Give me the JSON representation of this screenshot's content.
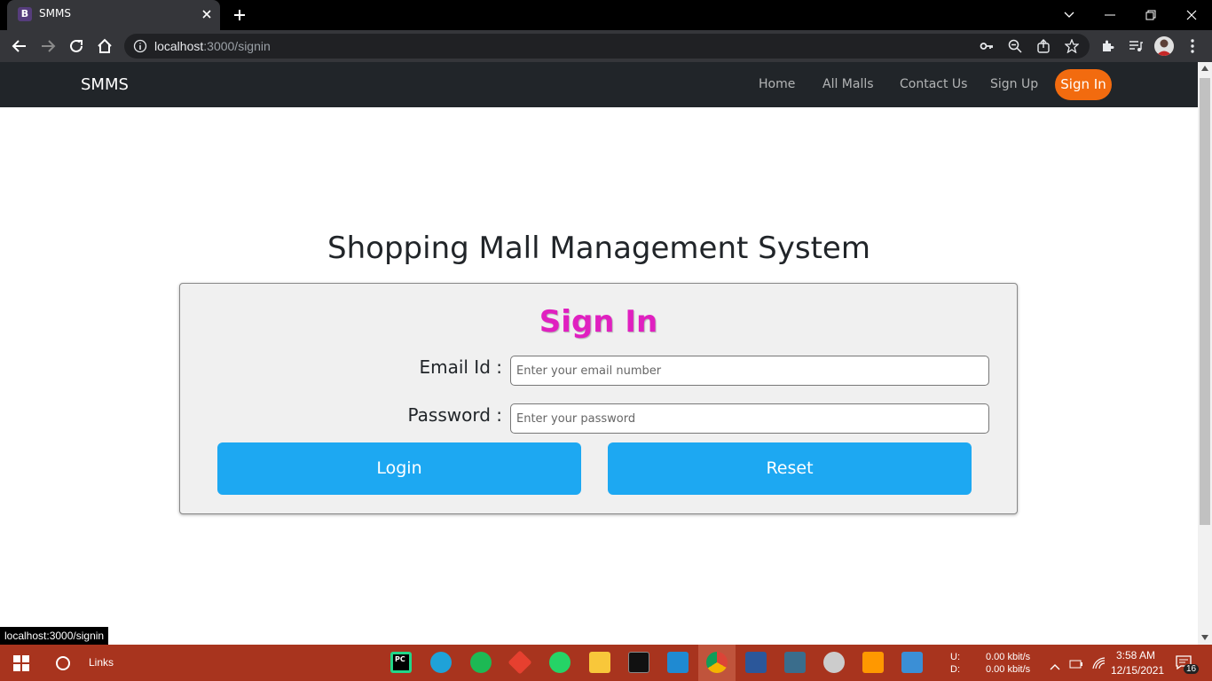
{
  "browser": {
    "tab_title": "SMMS",
    "tab_favicon": "B",
    "url_host": "localhost",
    "url_path": ":3000/signin",
    "status_url": "localhost:3000/signin"
  },
  "navbar": {
    "brand": "SMMS",
    "links": [
      "Home",
      "All Malls",
      "Contact Us",
      "Sign Up"
    ],
    "active": "Sign In"
  },
  "page": {
    "heading": "Shopping Mall Management System"
  },
  "signin_form": {
    "title": "Sign In",
    "email_label": "Email Id :",
    "email_placeholder": "Enter your email number",
    "password_label": "Password :",
    "password_placeholder": "Enter your password",
    "login_label": "Login",
    "reset_label": "Reset"
  },
  "colors": {
    "navbar_bg": "#212529",
    "signin_accent": "#f26b0f",
    "title_color": "#e020c0",
    "button_bg": "#1da8f2",
    "taskbar_bg": "#a8341e"
  },
  "taskbar": {
    "search_label": "Links",
    "net_up_label": "U:",
    "net_down_label": "D:",
    "net_up": "0.00 kbit/s",
    "net_down": "0.00 kbit/s",
    "time": "3:58 AM",
    "date": "12/15/2021",
    "notification_count": "16",
    "apps": [
      "pycharm-icon",
      "edge-icon",
      "spotify-icon",
      "git-icon",
      "whatsapp-icon",
      "file-explorer-icon",
      "terminal-icon",
      "vscode-icon",
      "chrome-icon",
      "word-icon",
      "mysql-workbench-icon",
      "settings-icon",
      "sublime-icon",
      "photos-icon"
    ]
  }
}
